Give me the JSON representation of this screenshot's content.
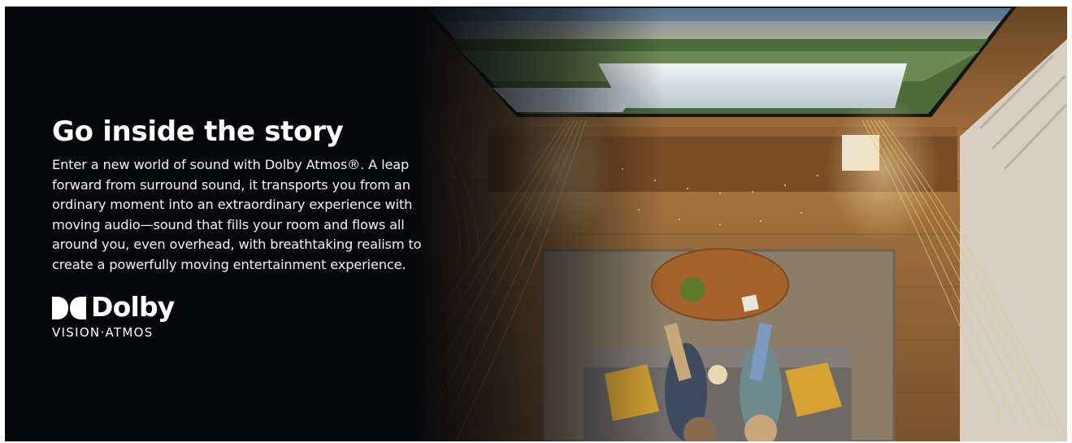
{
  "banner": {
    "headline": "Go inside the story",
    "body": "Enter a new world of sound with Dolby Atmos®. A leap forward from surround sound, it transports you from an ordinary moment into an extraordinary experience with moving audio—sound that fills your room and flows all around you, even overhead, with breathtaking realism to create a powerfully moving entertainment experience.",
    "body_lines": [
      "Enter a new world of sound with Dolby Atmos®. A leap",
      "forward from surround sound, it transports you from an",
      "ordinary moment into an extraordinary experience with",
      "moving audio—sound that fills your room and flows all",
      "around you, even overhead, with breathtaking realism to",
      "create a powerfully moving entertainment experience."
    ]
  },
  "logo": {
    "brand": "Dolby",
    "sub_brand": "VISION·ATMOS"
  },
  "colors": {
    "background": "#05070b",
    "text": "#ffffff",
    "sound_wave": "#e9c56a",
    "floor_wood": "#9a6a3c"
  }
}
